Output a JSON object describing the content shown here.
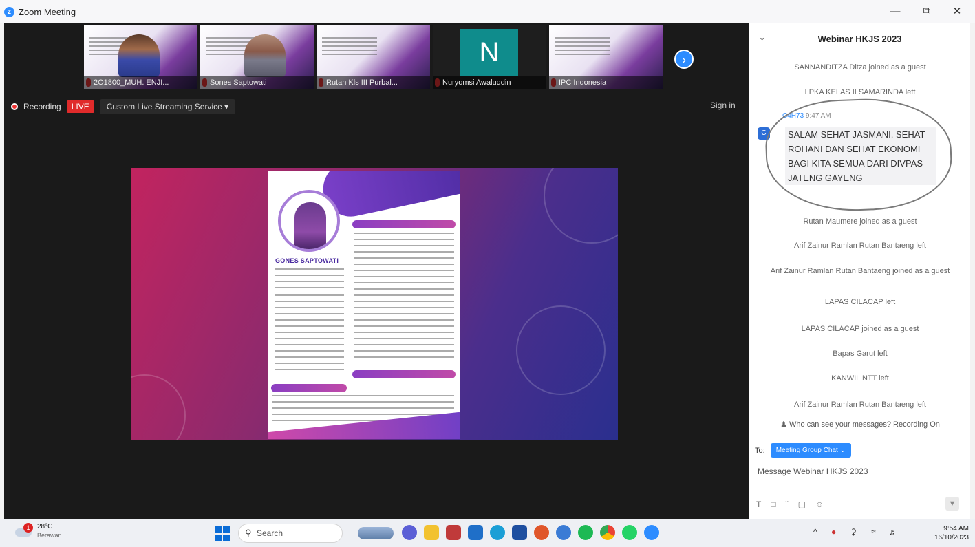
{
  "window": {
    "title": "Zoom Meeting",
    "minimize": "—",
    "restore": "⧉",
    "close": "✕"
  },
  "participants": [
    {
      "name": "2O1800_MUH. ENJI...",
      "kind": "video"
    },
    {
      "name": "Sones Saptowati",
      "kind": "video"
    },
    {
      "name": "Rutan Kls III Purbal...",
      "kind": "video"
    },
    {
      "name": "Nuryomsi Awaluddin",
      "kind": "initial",
      "initial": "N"
    },
    {
      "name": "IPC Indonesia",
      "kind": "video"
    }
  ],
  "recording": {
    "label": "Recording",
    "live": "LIVE",
    "stream": "Custom Live Streaming Service",
    "caret": "▾"
  },
  "signin": "Sign in",
  "poster": {
    "name": "GONES SAPTOWATI"
  },
  "chat": {
    "title": "Webinar HKJS 2023",
    "collapse": "⌄",
    "system_top": [
      "SANNANDITZA Ditza joined as a guest",
      "LPKA KELAS II SAMARINDA left"
    ],
    "message": {
      "avatar": "C",
      "sender": "C4H73",
      "time": "9:47 AM",
      "text": "SALAM SEHAT JASMANI, SEHAT ROHANI DAN SEHAT EKONOMI BAGI KITA SEMUA DARI DIVPAS JATENG GAYENG"
    },
    "system_bottom": [
      "Rutan Maumere joined as a guest",
      "Arif Zainur Ramlan Rutan Bantaeng left",
      "Arif Zainur Ramlan Rutan Bantaeng joined as a guest",
      "LAPAS CILACAP left",
      "LAPAS CILACAP joined as a guest",
      "Bapas Garut left",
      "KANWIL NTT left",
      "Arif Zainur Ramlan Rutan Bantaeng left"
    ],
    "who_can_see": "Who can see your messages? Recording On",
    "to_label": "To:",
    "to_target": "Meeting Group Chat ⌄",
    "placeholder": "Message Webinar HKJS 2023"
  },
  "taskbar": {
    "weather_temp": "28°C",
    "weather_desc": "Berawan",
    "weather_badge": "1",
    "search": "Search",
    "clock_time": "9:54 AM",
    "clock_date": "16/10/2023",
    "tray_chevron": "^"
  },
  "colors": {
    "accent": "#2d8cff",
    "live": "#e02b2b",
    "chat_bg": "#ffffff"
  }
}
